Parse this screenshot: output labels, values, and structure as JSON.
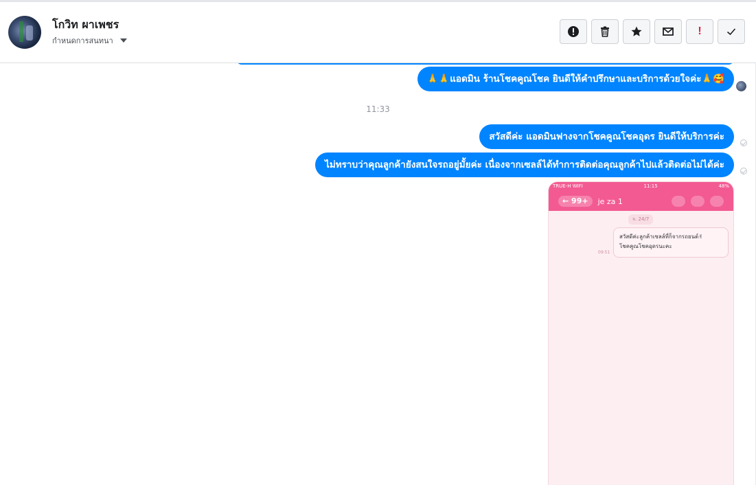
{
  "header": {
    "contact_name": "โกวิท ผาเพชร",
    "subtitle": "กำหนดการสนทนา",
    "actions": [
      {
        "name": "spam-button",
        "icon": "exclamation-circle-icon"
      },
      {
        "name": "delete-button",
        "icon": "trash-icon"
      },
      {
        "name": "star-button",
        "icon": "star-icon"
      },
      {
        "name": "mark-unread-button",
        "icon": "envelope-icon"
      },
      {
        "name": "important-button",
        "icon": "exclamation-icon",
        "label": "!"
      },
      {
        "name": "done-button",
        "icon": "check-icon"
      }
    ]
  },
  "messages": [
    {
      "text": "🙏🙏แอดมิน ร้านโชคคูณโชค ยินดีให้คำปรึกษาและบริการด้วยใจค่ะ🙏🥰"
    },
    {
      "text": "สวัสดีค่ะ แอดมินฟางจากโชคคูณโชคอุดร ยินดีให้บริการค่ะ"
    },
    {
      "text": "ไม่ทราบว่าคุณลูกค้ายังสนใจรถอยู่มั้ยค่ะ  เนื่องจากเซลล์ได้ทำการติดต่อคุณลูกค้าไปแล้วติดต่อไม่ได้ค่ะ"
    }
  ],
  "timestamp": "11:33",
  "attachment": {
    "carrier": "TRUE-H WIFI",
    "clock": "11:15",
    "battery": "48%",
    "badge": "99+",
    "chat_name": "je za 1",
    "date_chip": "จ. 24/7",
    "msg_line1": "สวัสดีค่ะลูกค้าเซลล์ที่ก็จากรถยนต์✌",
    "msg_line2": "โชคคูณโชคอุดรนะคะ",
    "msg_time": "09:51"
  },
  "colors": {
    "bubble": "#0084ff",
    "phone_header": "#f35a92"
  }
}
